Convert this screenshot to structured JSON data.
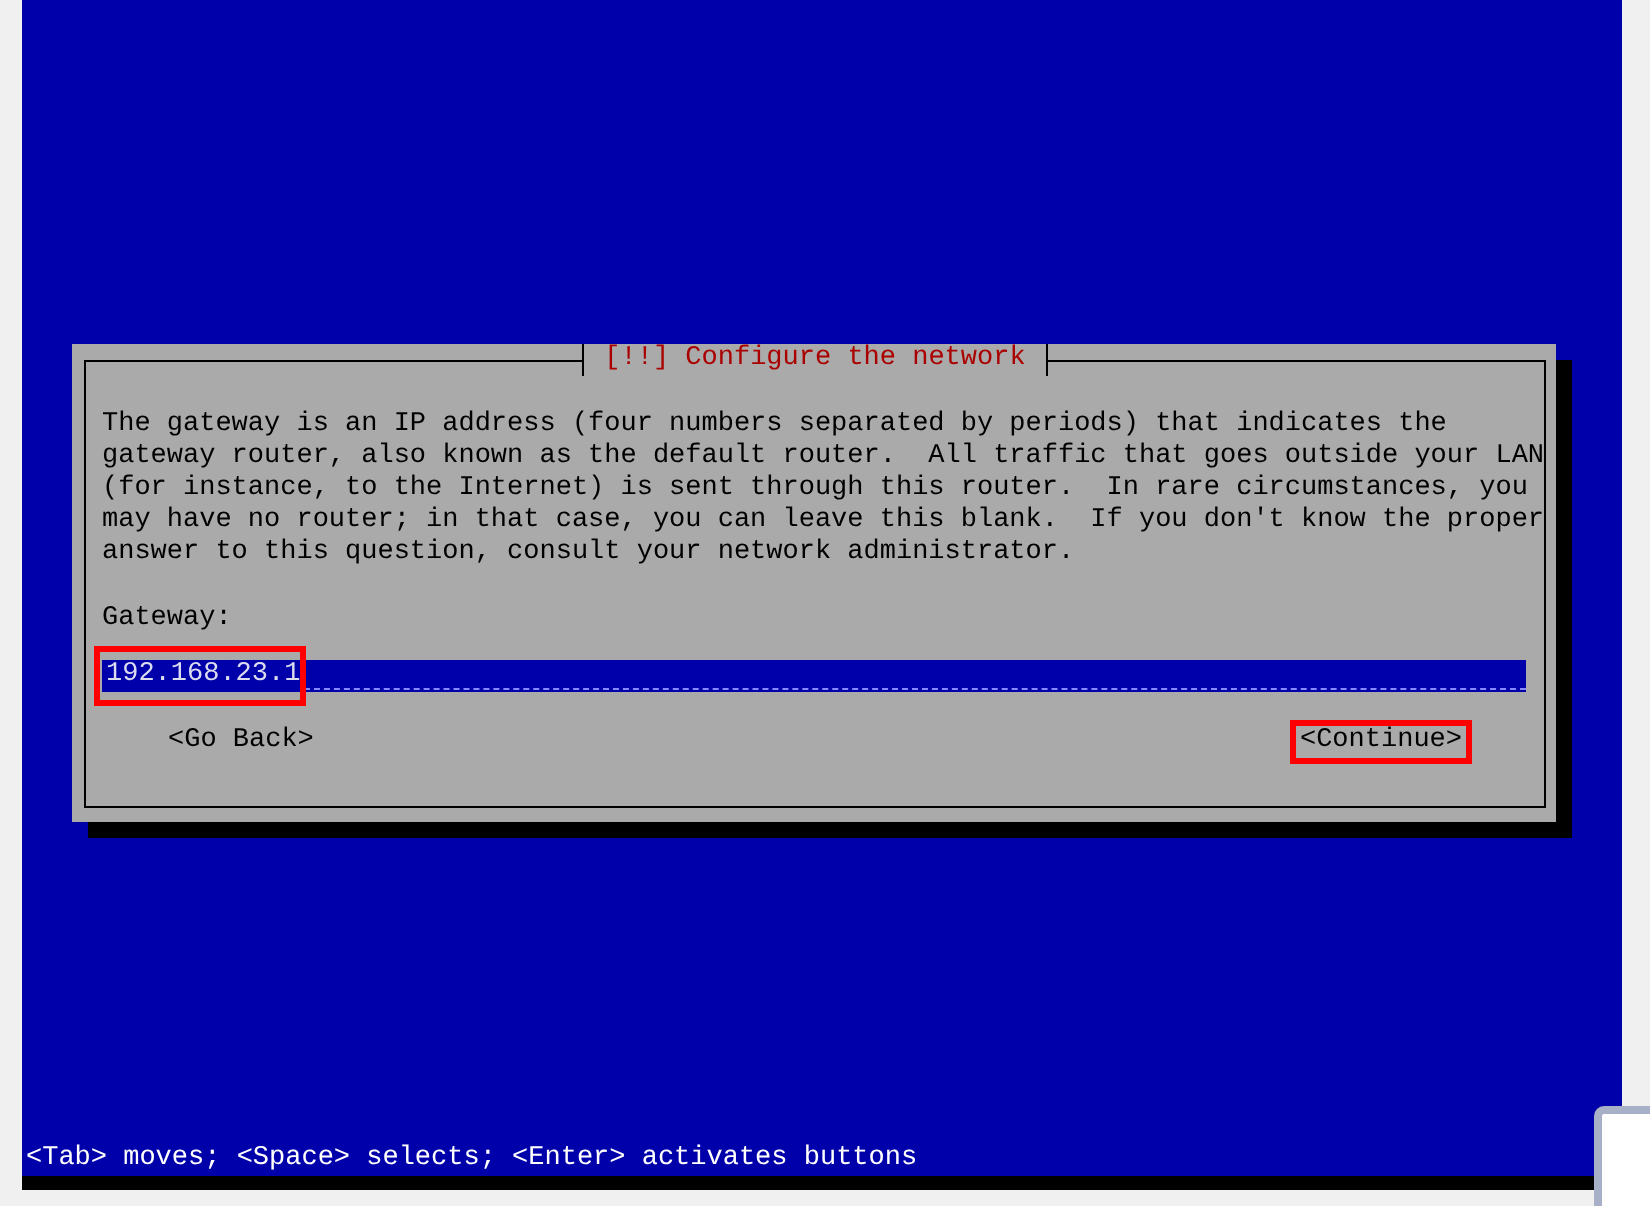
{
  "dialog": {
    "title": "[!!] Configure the network",
    "description_lines": [
      "The gateway is an IP address (four numbers separated by periods) that indicates the",
      "gateway router, also known as the default router.  All traffic that goes outside your LAN",
      "(for instance, to the Internet) is sent through this router.  In rare circumstances, you",
      "may have no router; in that case, you can leave this blank.  If you don't know the proper",
      "answer to this question, consult your network administrator."
    ],
    "field": {
      "label": "Gateway:",
      "value": "192.168.23.1",
      "highlighted": true
    },
    "buttons": [
      {
        "label": "<Go Back>",
        "highlighted": false
      },
      {
        "label": "<Continue>",
        "highlighted": true
      }
    ]
  },
  "status_bar": "<Tab> moves; <Space> selects; <Enter> activates buttons"
}
